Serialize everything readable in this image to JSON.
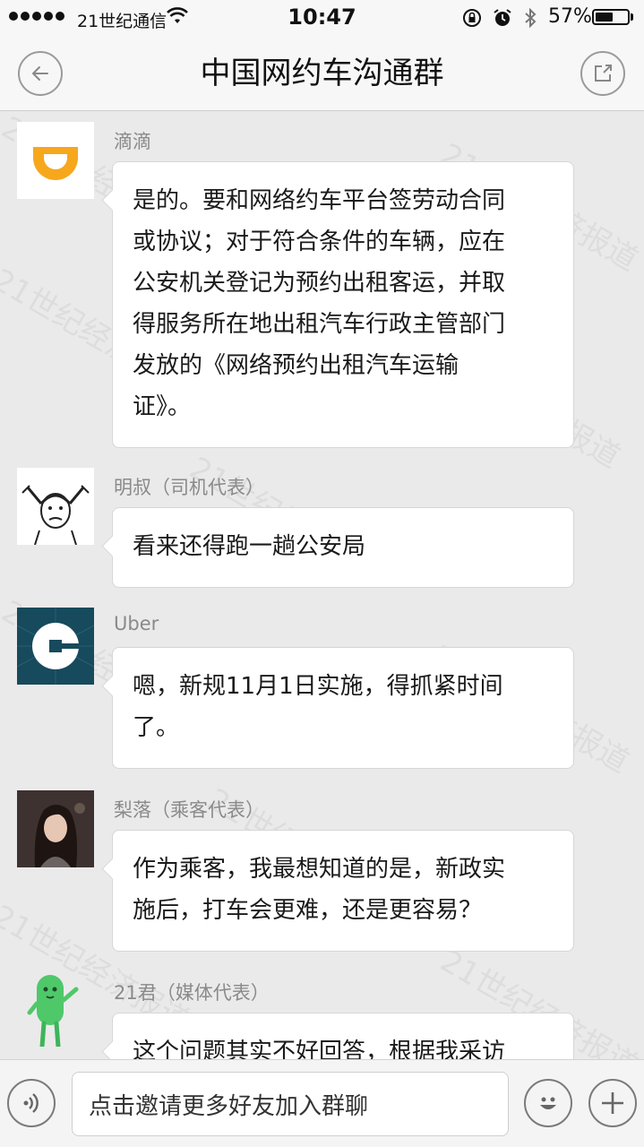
{
  "status_bar": {
    "carrier": "21世纪通信",
    "time": "10:47",
    "battery_percent": "57%",
    "battery_level": 0.57,
    "icons": [
      "signal-dots-icon",
      "wifi-icon",
      "orientation-lock-icon",
      "alarm-icon",
      "bluetooth-icon",
      "battery-icon"
    ]
  },
  "nav": {
    "title": "中国网约车沟通群",
    "back_icon": "back-arrow-icon",
    "share_icon": "share-external-icon"
  },
  "messages": [
    {
      "sender": "滴滴",
      "avatar": "didi-logo-avatar",
      "text": "是的。要和网络约车平台签劳动合同\n或协议；对于符合条件的车辆，应在\n公安机关登记为预约出租客运，并取\n得服务所在地出租汽车行政主管部门\n发放的《网络预约出租汽车运输\n证》。"
    },
    {
      "sender": "明叔（司机代表）",
      "avatar": "cartoon-man-avatar",
      "text": "看来还得跑一趟公安局"
    },
    {
      "sender": "Uber",
      "avatar": "uber-logo-avatar",
      "text": "嗯，新规11月1日实施，得抓紧时间\n了。"
    },
    {
      "sender": "梨落（乘客代表）",
      "avatar": "woman-photo-avatar",
      "text": "作为乘客，我最想知道的是，新政实\n施后，打车会更难，还是更容易？"
    },
    {
      "sender": "21君（媒体代表）",
      "avatar": "green-mascot-avatar",
      "text": "这个问题其实不好回答，根据我采访"
    }
  ],
  "watermark": "21世纪经济报道",
  "input_bar": {
    "placeholder": "点击邀请更多好友加入群聊",
    "voice_icon": "voice-icon",
    "emoji_icon": "emoji-icon",
    "plus_icon": "plus-icon"
  },
  "colors": {
    "didi_orange": "#f7a71b",
    "uber_teal": "#174a5c",
    "mascot_green": "#4fc86a",
    "background": "#eaeaea"
  }
}
